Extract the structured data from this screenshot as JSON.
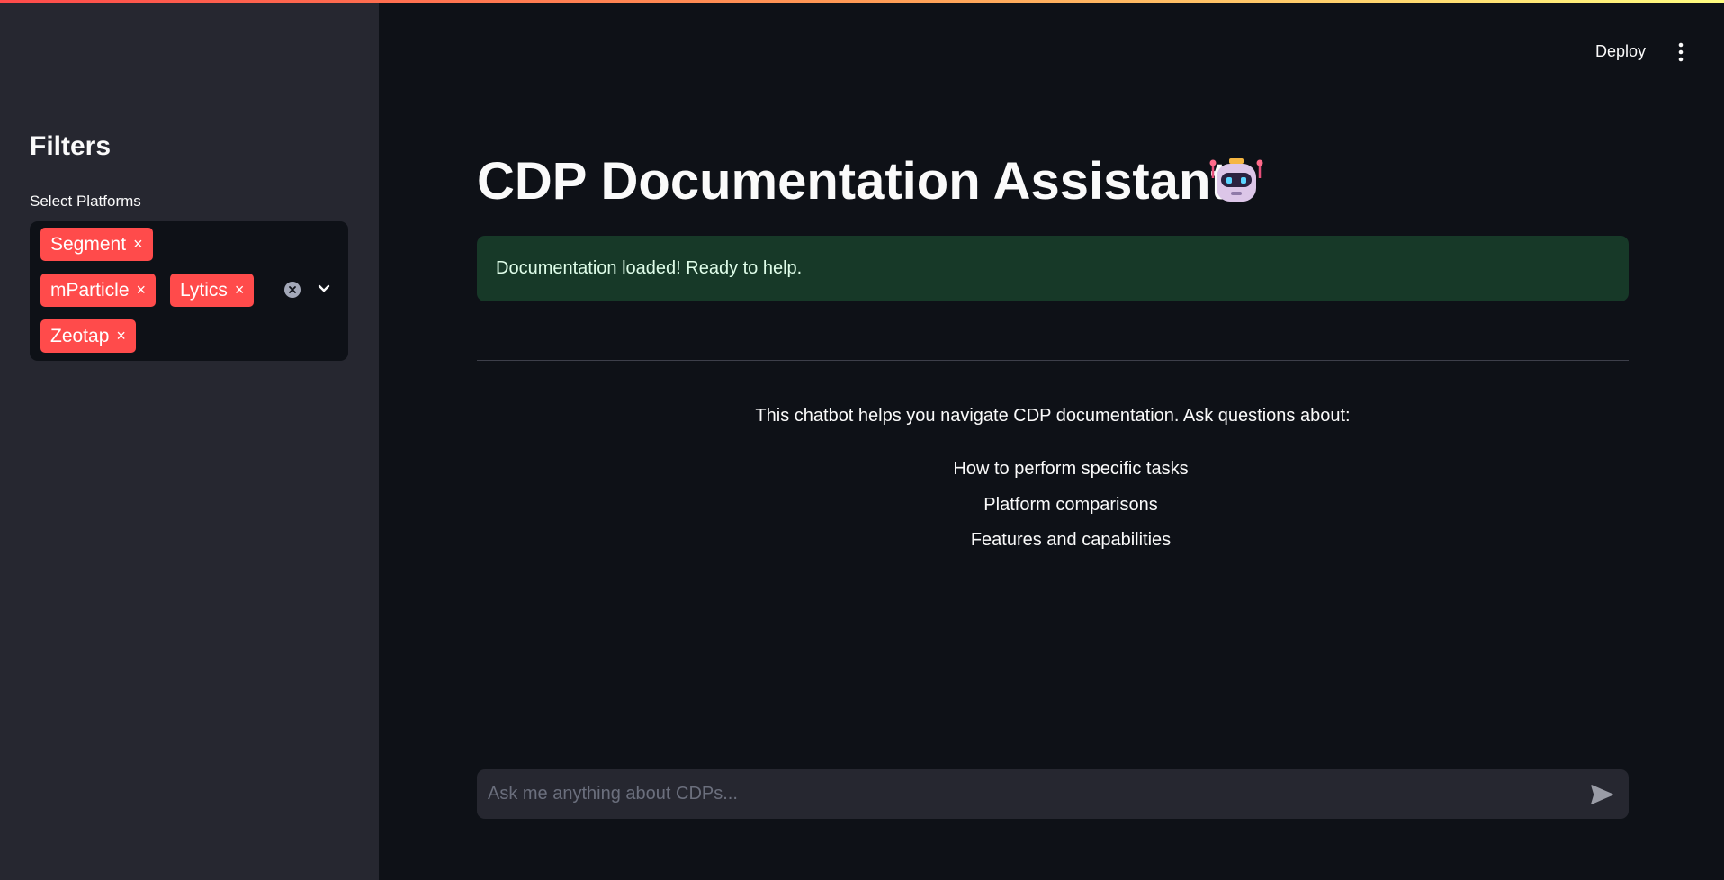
{
  "header": {
    "deploy_label": "Deploy",
    "menu_icon": "kebab-menu-icon"
  },
  "sidebar": {
    "title": "Filters",
    "select_label": "Select Platforms",
    "selected_platforms": [
      "Segment",
      "mParticle",
      "Lytics",
      "Zeotap"
    ],
    "remove_glyph": "×",
    "clear_icon": "clear-all-icon",
    "dropdown_icon": "chevron-down-icon"
  },
  "main": {
    "title": "CDP Documentation Assistant",
    "title_icon": "robot-icon",
    "success_message": "Documentation loaded! Ready to help.",
    "intro": "This chatbot helps you navigate CDP documentation. Ask questions about:",
    "topics": [
      "How to perform specific tasks",
      "Platform comparisons",
      "Features and capabilities"
    ]
  },
  "chat": {
    "placeholder": "Ask me anything about CDPs...",
    "send_icon": "send-icon"
  },
  "colors": {
    "background": "#0e1117",
    "sidebar": "#262730",
    "accent": "#ff4b4b",
    "success_bg": "#173928",
    "success_text": "#dffde9"
  }
}
